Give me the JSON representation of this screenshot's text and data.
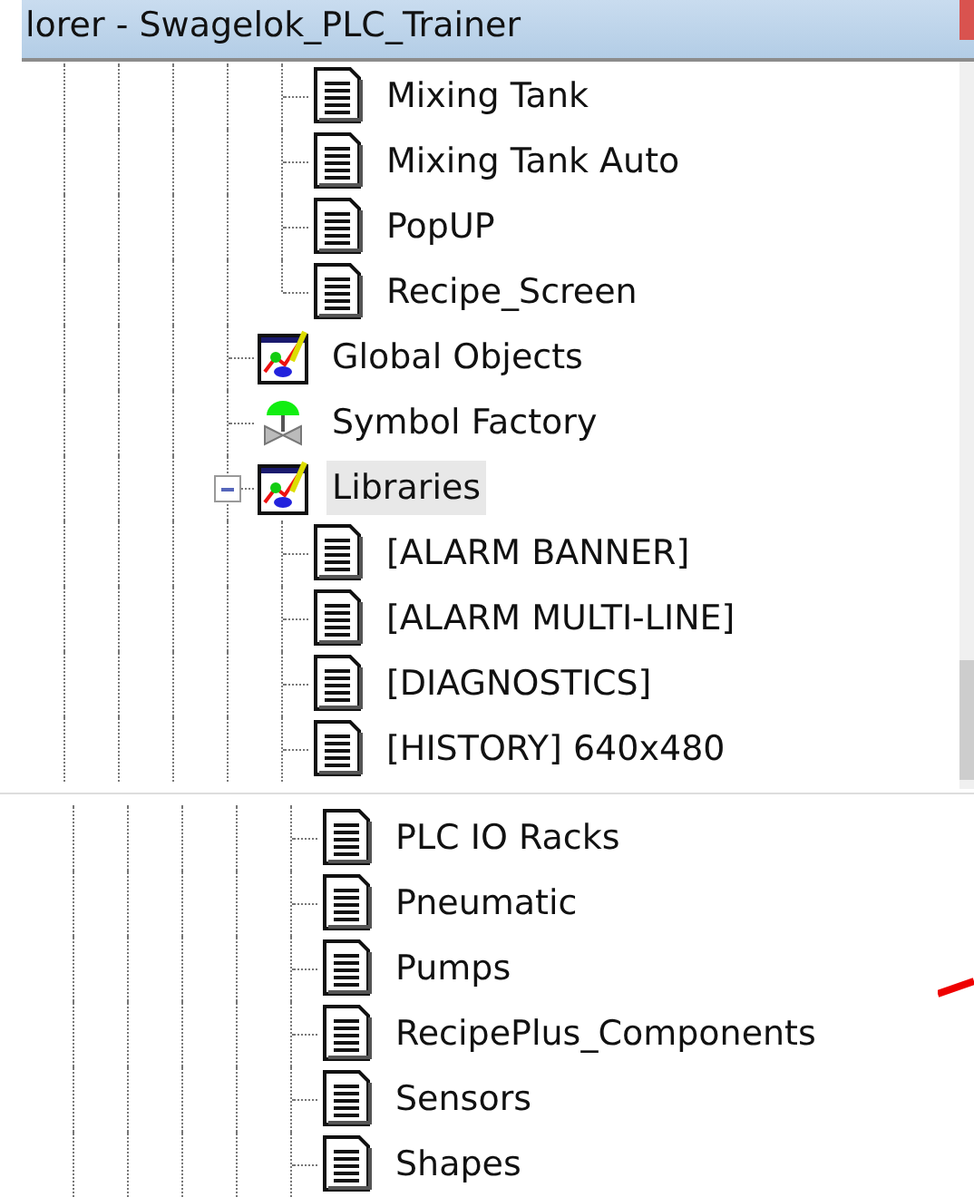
{
  "window": {
    "title": "lorer - Swagelok_PLC_Trainer"
  },
  "panels": [
    {
      "continued_children": [
        {
          "label": "Mixing Tank",
          "kind": "page",
          "selected": false
        },
        {
          "label": "Mixing Tank Auto",
          "kind": "page",
          "selected": false
        },
        {
          "label": "PopUP",
          "kind": "page",
          "selected": false
        },
        {
          "label": "Recipe_Screen",
          "kind": "page",
          "selected": false
        }
      ],
      "items": [
        {
          "label": "Global Objects",
          "kind": "folder",
          "selected": false
        },
        {
          "label": "Symbol Factory",
          "kind": "symbols",
          "selected": false
        },
        {
          "label": "Libraries",
          "kind": "folder",
          "selected": true,
          "expanded": true,
          "children": [
            {
              "label": "[ALARM BANNER]",
              "kind": "page",
              "selected": false
            },
            {
              "label": "[ALARM MULTI-LINE]",
              "kind": "page",
              "selected": false
            },
            {
              "label": "[DIAGNOSTICS]",
              "kind": "page",
              "selected": false
            },
            {
              "label": "[HISTORY] 640x480",
              "kind": "page",
              "selected": false
            }
          ]
        }
      ]
    },
    {
      "continued_children": [
        {
          "label": "PLC IO Racks",
          "kind": "page",
          "selected": false
        },
        {
          "label": "Pneumatic",
          "kind": "page",
          "selected": false
        },
        {
          "label": "Pumps",
          "kind": "page",
          "selected": false
        },
        {
          "label": "RecipePlus_Components",
          "kind": "page",
          "selected": false
        },
        {
          "label": "Sensors",
          "kind": "page",
          "selected": false
        },
        {
          "label": "Shapes",
          "kind": "page",
          "selected": false
        }
      ]
    }
  ]
}
